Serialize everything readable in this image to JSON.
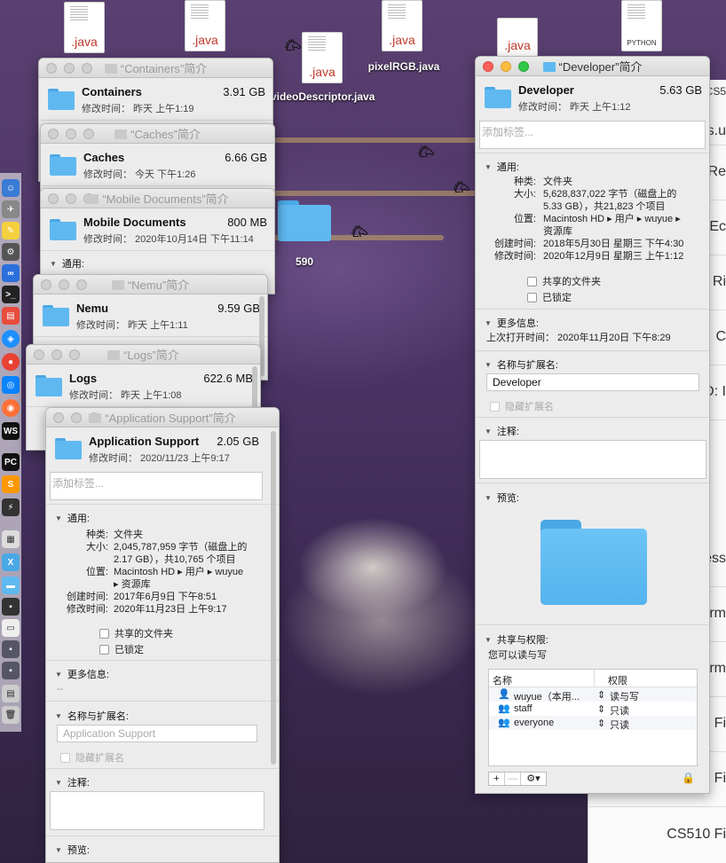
{
  "desktop": {
    "files": [
      {
        "badge": ".java",
        "label": ""
      },
      {
        "badge": ".java",
        "label": ""
      },
      {
        "badge": ".java",
        "label": "videoDescriptor.java"
      },
      {
        "badge": ".java",
        "label": "pixelRGB.java"
      },
      {
        "badge": ".java",
        "label": ""
      },
      {
        "badge": "PYTHON",
        "label": ""
      }
    ],
    "folder_label": "590"
  },
  "background_window": {
    "rows": [
      "CS5",
      "s.u",
      "Re",
      "Ec",
      "Ri",
      "C",
      "D: I",
      "ess",
      "rm",
      "rm",
      "Fi",
      "Fi",
      "CS510 Fi"
    ]
  },
  "windows": {
    "containers": {
      "title": "“Containers”简介",
      "name": "Containers",
      "size": "3.91 GB",
      "modified": "修改时间： 昨天 上午1:19"
    },
    "caches": {
      "title": "“Caches”简介",
      "name": "Caches",
      "size": "6.66 GB",
      "modified": "修改时间： 今天 下午1:26"
    },
    "mobile": {
      "title": "“Mobile Documents”简介",
      "name": "Mobile Documents",
      "size": "800 MB",
      "modified": "修改时间： 2020年10月14日 下午11:14",
      "general": "通用:"
    },
    "nemu": {
      "title": "“Nemu”简介",
      "name": "Nemu",
      "size": "9.59 GB",
      "modified": "修改时间： 昨天 上午1:11"
    },
    "logs": {
      "title": "“Logs”简介",
      "name": "Logs",
      "size": "622.6 MB",
      "modified": "修改时间： 昨天 上午1:08"
    },
    "appsupport": {
      "title": "“Application Support”简介",
      "name": "Application Support",
      "size": "2.05 GB",
      "modified": "修改时间： 2020/11/23 上午9:17",
      "tag_placeholder": "添加标签...",
      "general": "通用:",
      "kind_k": "种类:",
      "kind_v": "文件夹",
      "size_k": "大小:",
      "size_v1": "2,045,787,959 字节（磁盘上的",
      "size_v2": "2.17 GB），共10,765 个项目",
      "where_k": "位置:",
      "where_v1": "Macintosh HD ▸ 用户 ▸ wuyue",
      "where_v2": "▸ 资源库",
      "created_k": "创建时间:",
      "created_v": "2017年6月9日 下午8:51",
      "modified_k": "修改时间:",
      "modified_v": "2020年11月23日 上午9:17",
      "shared": "共享的文件夹",
      "locked": "已锁定",
      "more_info": "更多信息:",
      "more_info_value": "--",
      "name_ext": "名称与扩展名:",
      "name_field": "Application Support",
      "hide_ext": "隐藏扩展名",
      "comments": "注释:",
      "preview": "预览:"
    },
    "developer": {
      "title": "“Developer”简介",
      "name": "Developer",
      "size": "5.63 GB",
      "modified": "修改时间： 昨天 上午1:12",
      "tag_placeholder": "添加标签...",
      "general": "通用:",
      "kind_k": "种类:",
      "kind_v": "文件夹",
      "size_k": "大小:",
      "size_v1": "5,628,837,022 字节（磁盘上的",
      "size_v2": "5.33 GB），共21,823 个项目",
      "where_k": "位置:",
      "where_v1": "Macintosh HD ▸ 用户 ▸ wuyue ▸",
      "where_v2": "资源库",
      "created_k": "创建时间:",
      "created_v": "2018年5月30日 星期三 下午4:30",
      "modified_k": "修改时间:",
      "modified_v": "2020年12月9日 星期三 上午1:12",
      "shared": "共享的文件夹",
      "locked": "已锁定",
      "more_info": "更多信息:",
      "last_opened": "上次打开时间：  2020年11月20日 下午8:29",
      "name_ext": "名称与扩展名:",
      "name_field": "Developer",
      "hide_ext": "隐藏扩展名",
      "comments": "注释:",
      "preview": "预览:",
      "sharing": "共享与权限:",
      "can_rw": "您可以读与写",
      "col_name": "名称",
      "col_perm": "权限",
      "perms": [
        {
          "user": "wuyue（本用...",
          "perm": "读与写"
        },
        {
          "user": "staff",
          "perm": "只读"
        },
        {
          "user": "everyone",
          "perm": "只读"
        }
      ],
      "add": "+",
      "remove": "—",
      "gear": "⚙▾",
      "lock": "🔒"
    }
  },
  "colors": {
    "folder": "#5fb9f0",
    "close": "#fc605c",
    "minimize": "#fdbc40",
    "zoom": "#34c84a"
  }
}
